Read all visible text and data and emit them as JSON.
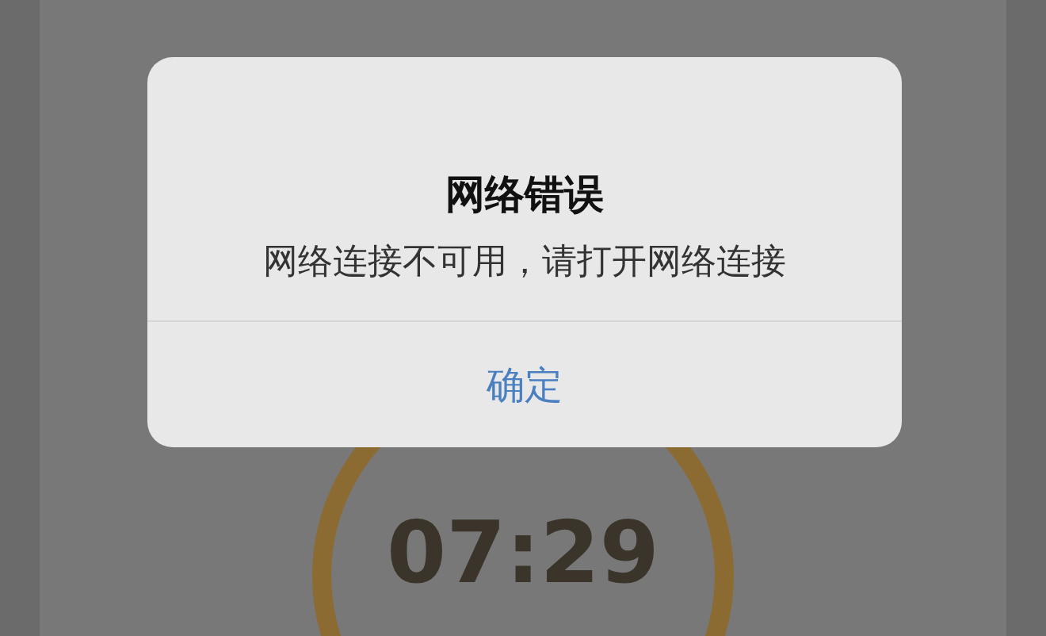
{
  "timer": {
    "time": "07:29"
  },
  "dialog": {
    "title": "网络错误",
    "message": "网络连接不可用，请打开网络连接",
    "buttons": [
      "确定"
    ]
  }
}
